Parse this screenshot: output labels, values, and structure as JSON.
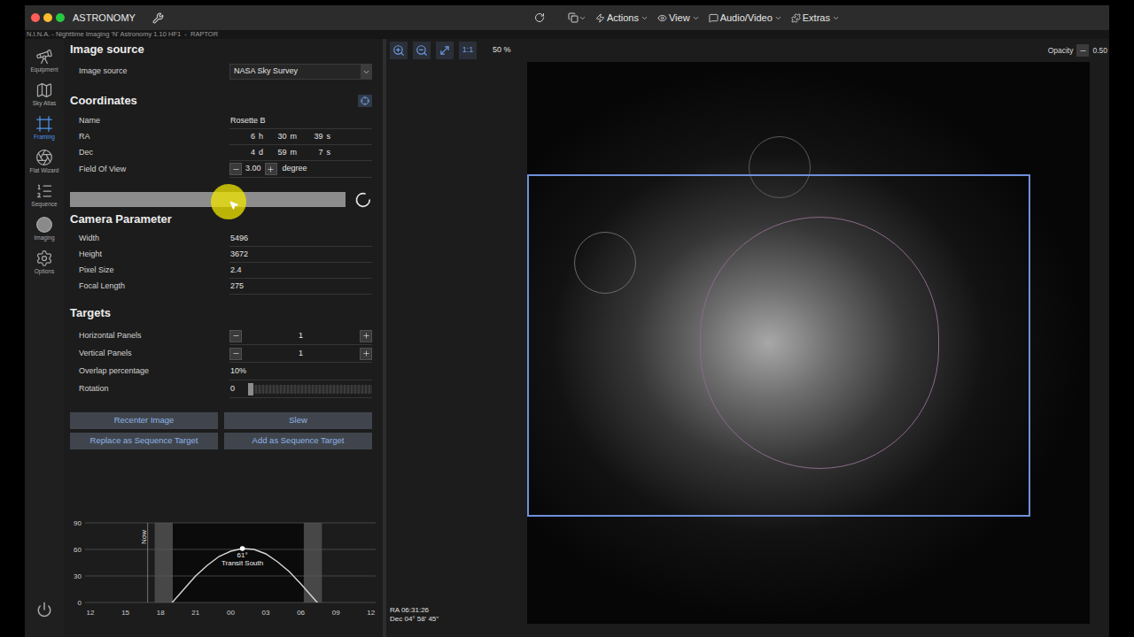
{
  "window": {
    "title": "ASTRONOMY",
    "subtitle": "N.I.N.A. - Nighttime Imaging 'N' Astronomy 1.10 HF1  -  RAPTOR"
  },
  "menu": [
    {
      "label": "Actions"
    },
    {
      "label": "View"
    },
    {
      "label": "Audio/Video"
    },
    {
      "label": "Extras"
    }
  ],
  "nav": [
    {
      "label": "Equipment",
      "selected": false
    },
    {
      "label": "Sky Atlas",
      "selected": false
    },
    {
      "label": "Framing",
      "selected": true
    },
    {
      "label": "Flat Wizard",
      "selected": false
    },
    {
      "label": "Sequence",
      "selected": false
    },
    {
      "label": "Imaging",
      "selected": false
    },
    {
      "label": "Options",
      "selected": false
    }
  ],
  "image_source": {
    "heading": "Image source",
    "label": "Image source",
    "value": "NASA Sky Survey"
  },
  "coordinates": {
    "heading": "Coordinates",
    "rows": [
      {
        "label": "Name",
        "kind": "text",
        "value": "Rosette B"
      },
      {
        "label": "RA",
        "kind": "parts",
        "parts": [
          {
            "value": "6",
            "unit": "h"
          },
          {
            "value": "30",
            "unit": "m"
          },
          {
            "value": "39",
            "unit": "s"
          }
        ]
      },
      {
        "label": "Dec",
        "kind": "parts",
        "parts": [
          {
            "value": "4",
            "unit": "d"
          },
          {
            "value": "59",
            "unit": "m"
          },
          {
            "value": "7",
            "unit": "s"
          }
        ]
      },
      {
        "label": "Field Of View",
        "kind": "fov",
        "value": "3.00",
        "unit": "degree"
      }
    ]
  },
  "loading": {
    "level": 1
  },
  "camera": {
    "heading": "Camera Parameter",
    "rows": [
      {
        "label": "Width",
        "value": "5496"
      },
      {
        "label": "Height",
        "value": "3672"
      },
      {
        "label": "Pixel Size",
        "value": "2.4"
      },
      {
        "label": "Focal Length",
        "value": "275"
      }
    ]
  },
  "targets": {
    "heading": "Targets",
    "rows": [
      {
        "label": "Horizontal Panels",
        "kind": "stepper",
        "value": "1"
      },
      {
        "label": "Vertical Panels",
        "kind": "stepper",
        "value": "1"
      },
      {
        "label": "Overlap percentage",
        "kind": "text",
        "value": "10%"
      },
      {
        "label": "Rotation",
        "kind": "slider",
        "value": "0",
        "level": 0
      }
    ]
  },
  "buttons": [
    {
      "label": "Recenter Image"
    },
    {
      "label": "Slew"
    },
    {
      "label": "Replace as Sequence Target"
    },
    {
      "label": "Add as Sequence Target"
    }
  ],
  "chart": {
    "y_ticks": [
      "90",
      "60",
      "30",
      "0"
    ],
    "x_ticks": [
      "12",
      "15",
      "18",
      "21",
      "00",
      "03",
      "06",
      "09",
      "12"
    ],
    "now_label": "Now",
    "now": 4.9,
    "peak_label": "61°",
    "peak_caption": "Transit South",
    "bands": [
      {
        "from": 5.5,
        "to": 7.05,
        "kind": "twilight"
      },
      {
        "from": 7.05,
        "to": 18.25,
        "kind": "night"
      },
      {
        "from": 18.25,
        "to": 19.8,
        "kind": "twilight"
      }
    ],
    "series": [
      {
        "name": "altitude",
        "values": [
          -55,
          -58,
          -56,
          -50,
          -41,
          -29,
          -15,
          0,
          15,
          30,
          42,
          52,
          58,
          61,
          60,
          55,
          46,
          35,
          21,
          6,
          -9,
          -23,
          -36,
          -46,
          -53
        ]
      }
    ]
  },
  "viewer": {
    "zoom": "50 %",
    "one_to_one": "1:1",
    "opacity_label": "Opacity",
    "opacity_value": "0.50",
    "ra": "RA 06:31:26",
    "dec": "Dec 04° 58' 45\""
  }
}
